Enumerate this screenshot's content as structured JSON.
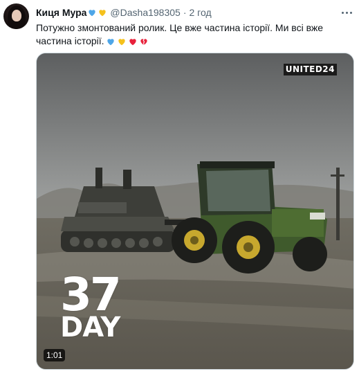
{
  "tweet": {
    "author_name": "Киця Мура",
    "handle": "@Dasha198305",
    "separator": "·",
    "timestamp": "2 год",
    "text": "Потужно змонтований ролик. Це вже частина історії. Ми всі вже частина історії.",
    "name_emojis": [
      "blue-heart-icon",
      "yellow-heart-icon"
    ],
    "text_emojis": [
      "blue-heart-icon",
      "yellow-heart-icon",
      "red-heart-icon",
      "broken-heart-icon"
    ]
  },
  "media": {
    "brand_label": "UNITED24",
    "overlay_number": "37",
    "overlay_word": "DAY",
    "duration": "1:01"
  },
  "colors": {
    "blue_heart": "#4ea6e8",
    "yellow_heart": "#f5c11c",
    "red_heart": "#e8213b",
    "secondary_text": "#536471"
  }
}
